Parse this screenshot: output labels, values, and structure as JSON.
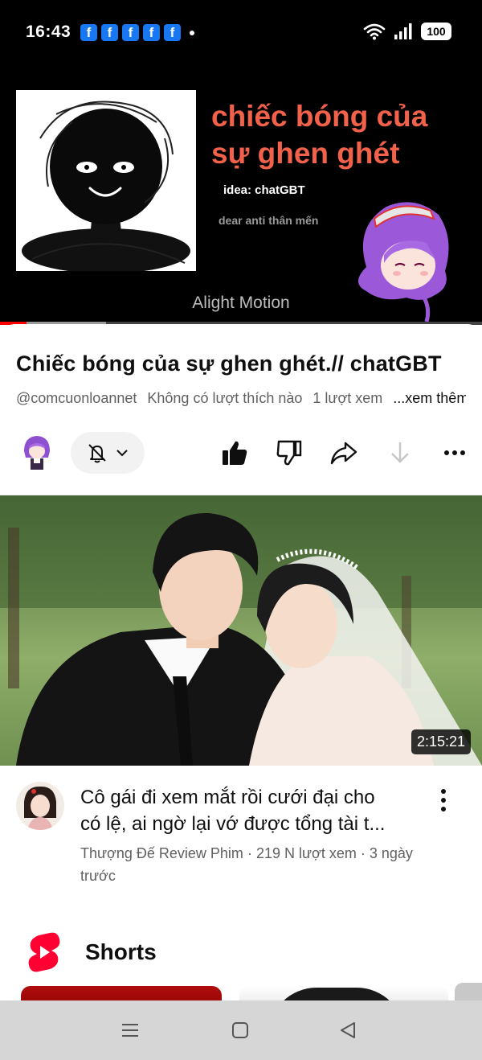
{
  "status_bar": {
    "time": "16:43",
    "notification_icons": [
      "f",
      "f",
      "f",
      "f",
      "f"
    ],
    "battery": "100"
  },
  "player": {
    "overlay_title": "chiếc bóng của sự ghen ghét",
    "idea_text": "idea: chatGBT",
    "dear_text": "dear anti thân mến",
    "watermark": "Alight Motion",
    "progress_played": 0.055,
    "progress_buffered": 0.22
  },
  "video": {
    "title": "Chiếc bóng của sự ghen ghét.// chatGBT",
    "channel": "@comcuonloannet",
    "likes_text": "Không có lượt thích nào",
    "views_text": "1 lượt xem",
    "more_text": "...xem thêm"
  },
  "recommended": {
    "duration": "2:15:21",
    "title_line1": "Cô gái đi xem mắt rồi cưới đại cho",
    "title_line2": "có lệ, ai ngờ lại vớ được tổng tài t...",
    "channel": "Thượng Đế Review Phim",
    "views": "219 N lượt xem",
    "age": "3 ngày trước",
    "separator": "·"
  },
  "shorts": {
    "title": "Shorts"
  },
  "colors": {
    "accent_red": "#ff0000",
    "overlay_title": "#f26149",
    "facebook_blue": "#1877f2"
  }
}
